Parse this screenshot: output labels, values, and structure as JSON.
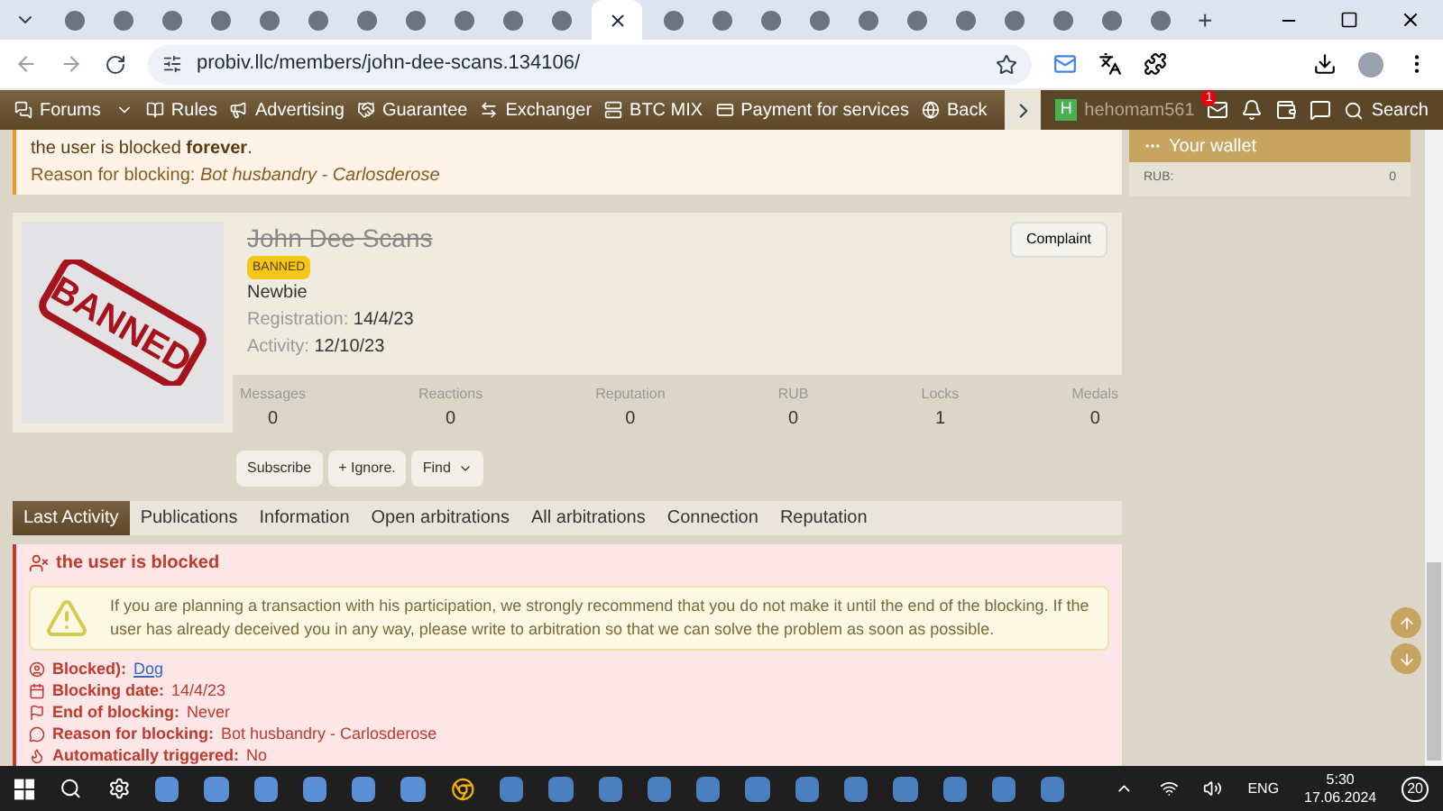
{
  "browser": {
    "tabs": [
      {
        "selected": false
      },
      {
        "selected": false
      },
      {
        "selected": false
      },
      {
        "selected": false
      },
      {
        "selected": false
      },
      {
        "selected": false
      },
      {
        "selected": false
      },
      {
        "selected": false
      },
      {
        "selected": false
      },
      {
        "selected": false
      },
      {
        "selected": false
      },
      {
        "selected": true
      },
      {
        "selected": false
      },
      {
        "selected": false
      },
      {
        "selected": false
      },
      {
        "selected": false
      },
      {
        "selected": false
      },
      {
        "selected": false
      },
      {
        "selected": false
      },
      {
        "selected": false
      },
      {
        "selected": false
      },
      {
        "selected": false
      },
      {
        "selected": false
      }
    ],
    "new_tab": "+",
    "url": "probiv.llc/members/john-dee-scans.134106/"
  },
  "nav": {
    "items": [
      {
        "label": "Forums",
        "dropdown": true
      },
      {
        "label": "Rules",
        "dropdown": false
      },
      {
        "label": "Advertising",
        "dropdown": false
      },
      {
        "label": "Guarantee",
        "dropdown": false
      },
      {
        "label": "Exchanger",
        "dropdown": false
      },
      {
        "label": "BTC MIX",
        "dropdown": false
      },
      {
        "label": "Payment for services",
        "dropdown": false
      },
      {
        "label": "Back",
        "dropdown": false
      }
    ],
    "user": {
      "initial": "H",
      "name": "hehomam561"
    },
    "inbox_badge": "1",
    "search": "Search"
  },
  "notice": {
    "line1": "the user is blocked **forever**.",
    "line2_label": "Reason for blocking:",
    "line2_value": "Bot husbandry - Carlosderose"
  },
  "wallet": {
    "title": "Your wallet",
    "label": "RUB:",
    "value": "0"
  },
  "profile": {
    "stamp": "BANNED",
    "name": "John Dee Scans",
    "badge": "BANNED",
    "rank": "Newbie",
    "registration_label": "Registration:",
    "registration": "14/4/23",
    "activity_label": "Activity:",
    "activity": "12/10/23",
    "complaint": "Complaint",
    "stats": [
      {
        "label": "Messages",
        "value": "0"
      },
      {
        "label": "Reactions",
        "value": "0"
      },
      {
        "label": "Reputation",
        "value": "0"
      },
      {
        "label": "RUB",
        "value": "0"
      },
      {
        "label": "Locks",
        "value": "1"
      },
      {
        "label": "Medals",
        "value": "0"
      }
    ],
    "buttons": [
      {
        "label": "Subscribe",
        "kind": "plain"
      },
      {
        "label": "+ Ignore.",
        "kind": "plain"
      },
      {
        "label": "Find",
        "kind": "menu"
      }
    ]
  },
  "tabs": [
    {
      "label": "Last Activity",
      "selected": true
    },
    {
      "label": "Publications",
      "selected": false
    },
    {
      "label": "Information",
      "selected": false
    },
    {
      "label": "Open arbitrations",
      "selected": false
    },
    {
      "label": "All arbitrations",
      "selected": false
    },
    {
      "label": "Connection",
      "selected": false
    },
    {
      "label": "Reputation",
      "selected": false
    }
  ],
  "blocked": {
    "title": "the user is blocked",
    "warning": "If you are planning a transaction with his participation, we strongly recommend that you do not make it until the end of the blocking. If the user has already deceived you in any way, please write to arbitration so that we can solve the problem as soon as possible.",
    "details": [
      {
        "kind": "user",
        "label": "Blocked):",
        "value": "Dog",
        "link": true
      },
      {
        "kind": "calendar",
        "label": "Blocking date:",
        "value": "14/4/23",
        "link": false
      },
      {
        "kind": "flag",
        "label": "End of blocking:",
        "value": "Never",
        "link": false
      },
      {
        "kind": "comment",
        "label": "Reason for blocking:",
        "value": "Bot husbandry - Carlosderose",
        "link": false
      },
      {
        "kind": "fire",
        "label": "Automatically triggered:",
        "value": "No",
        "link": false
      }
    ]
  },
  "taskbar": {
    "language": "ENG",
    "time": "5:30",
    "date": "17.06.2024",
    "notifications": "20"
  }
}
